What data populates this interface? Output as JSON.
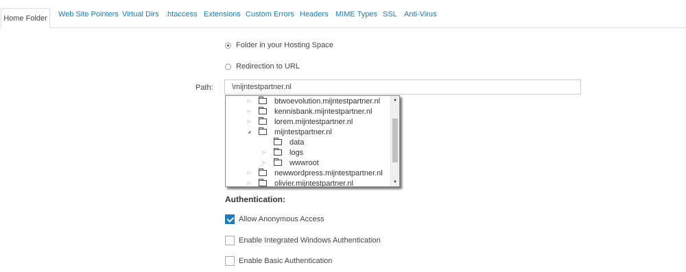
{
  "tabs": [
    "Home Folder",
    "Web Site Pointers",
    "Virtual Dirs",
    ".htaccess",
    "Extensions",
    "Custom Errors",
    "Headers",
    "MIME Types",
    "SSL",
    "Anti-Virus"
  ],
  "options": {
    "folder_label": "Folder in your Hosting Space",
    "redirect_label": "Redirection to URL",
    "selected": "folder"
  },
  "path": {
    "label": "Path:",
    "value": "\\mijntestpartner.nl"
  },
  "tree": {
    "items": [
      {
        "label": "btwoevolution.mijntestpartner.nl",
        "arrow": "collapsed"
      },
      {
        "label": "kennisbank.mijntestpartner.nl",
        "arrow": "collapsed"
      },
      {
        "label": "lorem.mijntestpartner.nl",
        "arrow": "collapsed"
      },
      {
        "label": "mijntestpartner.nl",
        "arrow": "expanded"
      },
      {
        "label": "data",
        "arrow": "none"
      },
      {
        "label": "logs",
        "arrow": "collapsed"
      },
      {
        "label": "wwwroot",
        "arrow": "collapsed"
      },
      {
        "label": "newwordpress.mijntestpartner.nl",
        "arrow": "collapsed"
      },
      {
        "label": "olivier.mijntestpartner.nl",
        "arrow": "collapsed"
      }
    ]
  },
  "auth": {
    "title": "Authentication:",
    "anonymous_label": "Allow Anonymous Access",
    "anonymous_checked": true,
    "windows_label": "Enable Integrated Windows Authentication",
    "windows_checked": false,
    "basic_label": "Enable Basic Authentication",
    "basic_checked": false
  },
  "colors": {
    "accent": "#1a7bc0",
    "border": "#dddddd"
  }
}
